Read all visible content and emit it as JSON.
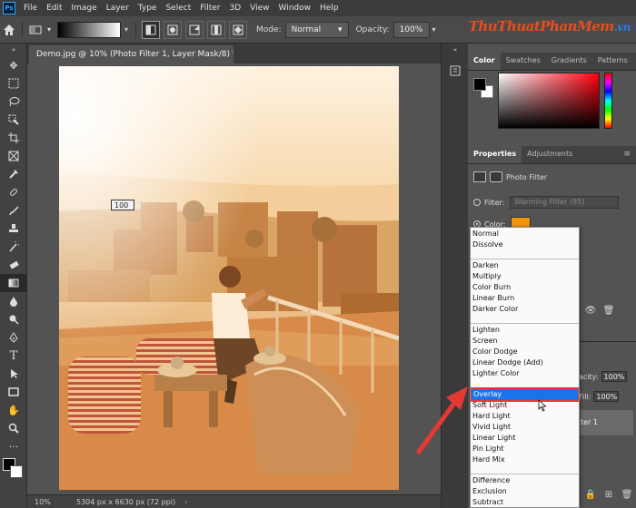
{
  "app": {
    "logo": "Ps",
    "menu": [
      "File",
      "Edit",
      "Image",
      "Layer",
      "Type",
      "Select",
      "Filter",
      "3D",
      "View",
      "Window",
      "Help"
    ]
  },
  "options_bar": {
    "mode_label": "Mode:",
    "mode_value": "Normal",
    "opacity_label": "Opacity:",
    "opacity_value": "100%"
  },
  "watermark": {
    "text": "ThuThuatPhanMem",
    "domain": ".vn"
  },
  "document": {
    "tab_title": "Demo.jpg @ 10% (Photo Filter 1, Layer Mask/8) *",
    "tab_close": "×",
    "zoom": "10%",
    "info": "5304 px x 6630 px (72 ppi)",
    "status_arrow": "›"
  },
  "color_panel": {
    "tabs": [
      "Color",
      "Swatches",
      "Gradients",
      "Patterns"
    ],
    "active_tab": 0,
    "foreground": "#000000",
    "background": "#ffffff"
  },
  "properties_panel": {
    "tabs": [
      "Properties",
      "Adjustments"
    ],
    "active_tab": 0,
    "title": "Photo Filter",
    "filter_label": "Filter:",
    "filter_value": "Warming Filter (85)",
    "color_label": "Color:",
    "color_value": "#f2950a",
    "density_value": "100",
    "density_unit": "%"
  },
  "layers_panel": {
    "opacity_label": "acity:",
    "opacity_value": "100%",
    "fill_label": "Fill:",
    "fill_value": "100%",
    "layer_name": "ter 1"
  },
  "blend_dropdown": {
    "groups": [
      [
        "Normal",
        "Dissolve"
      ],
      [
        "Darken",
        "Multiply",
        "Color Burn",
        "Linear Burn",
        "Darker Color"
      ],
      [
        "Lighten",
        "Screen",
        "Color Dodge",
        "Linear Dodge (Add)",
        "Lighter Color"
      ],
      [
        "Overlay",
        "Soft Light",
        "Hard Light",
        "Vivid Light",
        "Linear Light",
        "Pin Light",
        "Hard Mix"
      ],
      [
        "Difference",
        "Exclusion",
        "Subtract"
      ]
    ],
    "selected": "Overlay"
  },
  "colors": {
    "annotation_arrow": "#e53935",
    "selection": "#1a73e8",
    "photo_filter": "#f2950a"
  }
}
